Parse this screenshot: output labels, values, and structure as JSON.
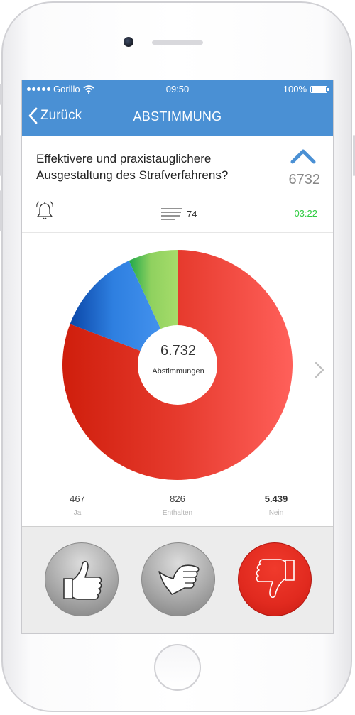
{
  "status_bar": {
    "carrier": "Gorillo",
    "time": "09:50",
    "battery": "100%"
  },
  "nav": {
    "back_label": "Zurück",
    "title": "ABSTIMMUNG"
  },
  "question": {
    "text": "Effektivere und praxistauglichere Ausgestaltung des Strafverfahrens?",
    "upvote_count": "6732",
    "comment_count": "74",
    "time_left": "03:22"
  },
  "chart_data": {
    "type": "pie",
    "categories": [
      "Ja",
      "Enthalten",
      "Nein"
    ],
    "values": [
      467,
      826,
      5439
    ],
    "colors": [
      "#8fd15f",
      "#3a8ae6",
      "#e8382c"
    ],
    "total_label": "6.732",
    "center_label": "Abstimmungen"
  },
  "tallies": [
    {
      "value": "467",
      "label": "Ja"
    },
    {
      "value": "826",
      "label": "Enthalten"
    },
    {
      "value": "5.439",
      "label": "Nein"
    }
  ],
  "vote_buttons": {
    "yes": "thumbs-up-icon",
    "abstain": "thumb-sideways-icon",
    "no": "thumbs-down-icon",
    "selected": "no"
  }
}
